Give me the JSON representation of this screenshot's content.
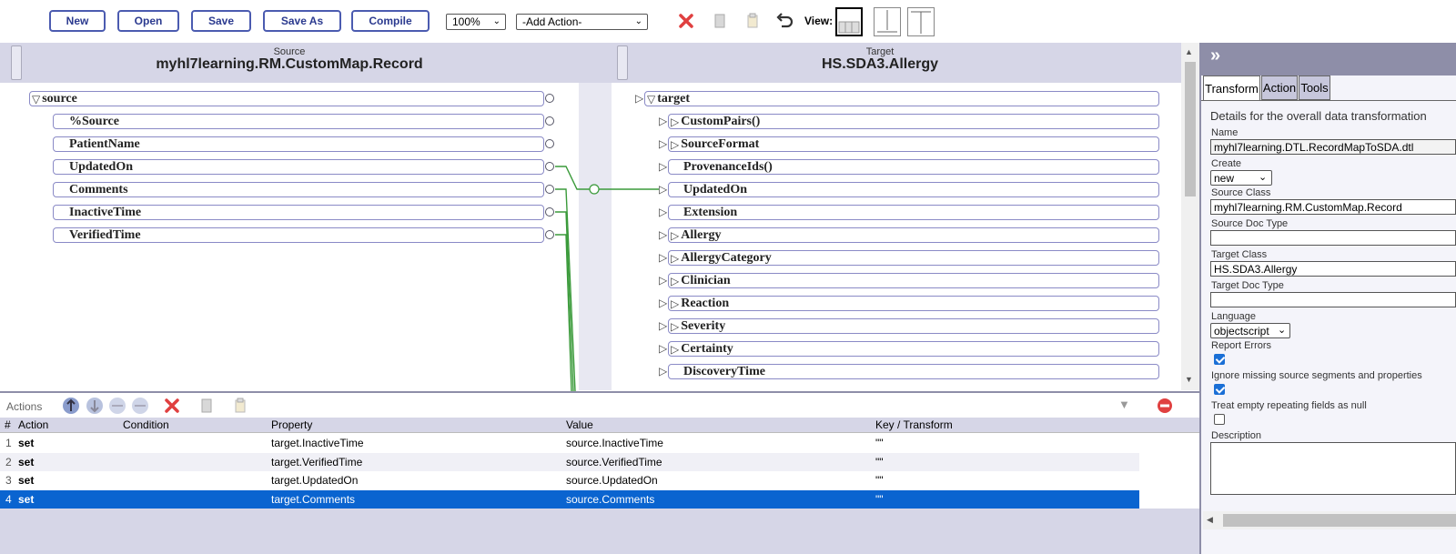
{
  "toolbar": {
    "new_label": "New",
    "open_label": "Open",
    "save_label": "Save",
    "save_as_label": "Save As",
    "compile_label": "Compile",
    "zoom_value": "100%",
    "add_action_value": "-Add Action-",
    "view_label": "View:"
  },
  "source": {
    "caption": "Source",
    "class_name": "myhl7learning.RM.CustomMap.Record",
    "root": "source",
    "fields": [
      "%Source",
      "PatientName",
      "UpdatedOn",
      "Comments",
      "InactiveTime",
      "VerifiedTime"
    ]
  },
  "target": {
    "caption": "Target",
    "class_name": "HS.SDA3.Allergy",
    "root": "target",
    "fields": [
      {
        "name": "CustomPairs()",
        "expandable": true
      },
      {
        "name": "SourceFormat",
        "expandable": true
      },
      {
        "name": "ProvenanceIds()",
        "expandable": false
      },
      {
        "name": "UpdatedOn",
        "expandable": false
      },
      {
        "name": "Extension",
        "expandable": false
      },
      {
        "name": "Allergy",
        "expandable": true
      },
      {
        "name": "AllergyCategory",
        "expandable": true
      },
      {
        "name": "Clinician",
        "expandable": true
      },
      {
        "name": "Reaction",
        "expandable": true
      },
      {
        "name": "Severity",
        "expandable": true
      },
      {
        "name": "Certainty",
        "expandable": true
      },
      {
        "name": "DiscoveryTime",
        "expandable": false
      }
    ]
  },
  "actions": {
    "label": "Actions",
    "columns": {
      "num": "#",
      "action": "Action",
      "condition": "Condition",
      "property": "Property",
      "value": "Value",
      "key": "Key / Transform"
    },
    "rows": [
      {
        "num": "1",
        "action": "set",
        "condition": "",
        "property": "target.InactiveTime",
        "value": "source.InactiveTime",
        "key": "\"\""
      },
      {
        "num": "2",
        "action": "set",
        "condition": "",
        "property": "target.VerifiedTime",
        "value": "source.VerifiedTime",
        "key": "\"\""
      },
      {
        "num": "3",
        "action": "set",
        "condition": "",
        "property": "target.UpdatedOn",
        "value": "source.UpdatedOn",
        "key": "\"\""
      },
      {
        "num": "4",
        "action": "set",
        "condition": "",
        "property": "target.Comments",
        "value": "source.Comments",
        "key": "\"\""
      }
    ]
  },
  "panel": {
    "expand_glyph": "»",
    "tabs": [
      "Transform",
      "Action",
      "Tools"
    ],
    "heading": "Details for the overall data transformation",
    "name_label": "Name",
    "name_value": "myhl7learning.DTL.RecordMapToSDA.dtl",
    "create_label": "Create",
    "create_value": "new",
    "source_class_label": "Source Class",
    "source_class_value": "myhl7learning.RM.CustomMap.Record",
    "source_doc_type_label": "Source Doc Type",
    "source_doc_type_value": "",
    "target_class_label": "Target Class",
    "target_class_value": "HS.SDA3.Allergy",
    "target_doc_type_label": "Target Doc Type",
    "target_doc_type_value": "",
    "language_label": "Language",
    "language_value": "objectscript",
    "report_errors_label": "Report Errors",
    "report_errors_checked": true,
    "ignore_missing_label": "Ignore missing source segments and properties",
    "ignore_missing_checked": true,
    "treat_empty_label": "Treat empty repeating fields as null",
    "treat_empty_checked": false,
    "description_label": "Description",
    "description_value": ""
  },
  "colors": {
    "header_bg": "#d6d6e7",
    "selected_row": "#0a64d0",
    "link_line": "#3a9a3a",
    "button_border": "#4b5bb0"
  }
}
